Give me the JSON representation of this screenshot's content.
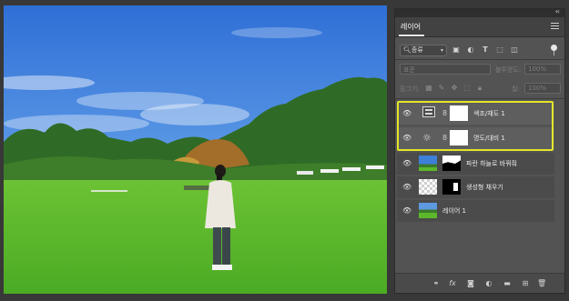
{
  "panel": {
    "collapse_label": "‹‹",
    "tab_label": "레이어",
    "filter_kind": "종류",
    "blend_mode": "표준",
    "opacity_label": "불투명도:",
    "opacity_value": "100%",
    "lock_label": "잠그기:",
    "fill_label": "칠:",
    "fill_value": "100%"
  },
  "layers": [
    {
      "name": "색조/채도 1",
      "type": "adjustment-hue",
      "selected": true
    },
    {
      "name": "명도/대비 1",
      "type": "adjustment-brightness",
      "selected": true
    },
    {
      "name": "파란 하늘로 바꿔줘",
      "type": "generative",
      "selected": false
    },
    {
      "name": "생성형 채우기",
      "type": "generative",
      "selected": false
    },
    {
      "name": "레이어 1",
      "type": "pixel",
      "selected": false
    }
  ],
  "colors": {
    "selection_outline": "#e3e629",
    "panel_bg": "#535353",
    "canvas_sky": "#3f7fd8",
    "canvas_grass": "#55b82a"
  },
  "icons": [
    "search-icon",
    "image-filter-icon",
    "adjustment-filter-icon",
    "type-filter-icon",
    "shape-filter-icon",
    "smart-object-filter-icon",
    "visibility-icon",
    "link-icon",
    "fx-icon",
    "mask-icon",
    "adjustment-icon",
    "folder-icon",
    "new-layer-icon",
    "trash-icon"
  ]
}
